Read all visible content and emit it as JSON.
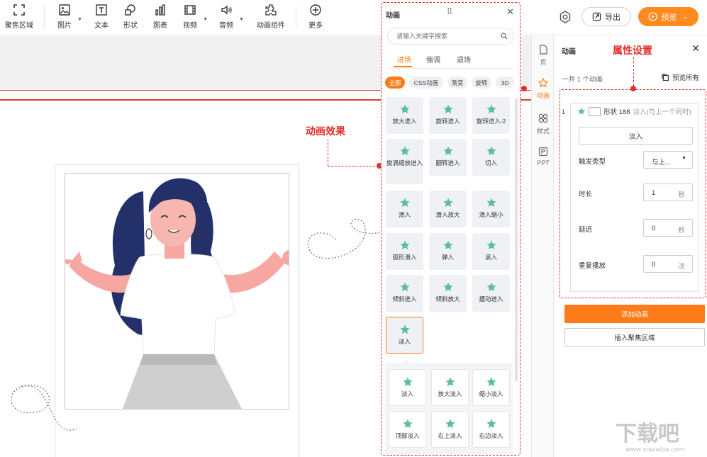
{
  "toolbar": {
    "items": [
      {
        "label": "聚焦区域",
        "icon": "focus-area-icon"
      },
      {
        "label": "图片",
        "icon": "image-icon"
      },
      {
        "label": "文本",
        "icon": "text-icon"
      },
      {
        "label": "形状",
        "icon": "shape-icon"
      },
      {
        "label": "图表",
        "icon": "chart-icon"
      },
      {
        "label": "视频",
        "icon": "video-icon"
      },
      {
        "label": "音频",
        "icon": "audio-icon"
      },
      {
        "label": "动画组件",
        "icon": "animation-component-icon"
      },
      {
        "label": "更多",
        "icon": "more-icon"
      }
    ],
    "export_label": "导出",
    "preview_label": "预览"
  },
  "annotations": {
    "effects": "动画效果",
    "properties": "属性设置"
  },
  "anim_panel": {
    "title": "动画",
    "search_placeholder": "请输入关键字搜索",
    "tabs": [
      "进场",
      "强调",
      "退场"
    ],
    "chips": [
      "全部",
      "CSS动画",
      "渐变",
      "旋转",
      "3D"
    ],
    "effects": [
      "放大进入",
      "旋转进入",
      "旋转进入-2",
      "旋涡缩放进入",
      "翻转进入",
      "切入",
      "滑入",
      "滑入放大",
      "滑入缩小",
      "弧形滑入",
      "弹入",
      "滚入",
      "倾斜进入",
      "倾斜放大",
      "摆动进入",
      "淡入"
    ],
    "sub_effects": [
      "淡入",
      "放大淡入",
      "缩小淡入",
      "顶部淡入",
      "右上淡入",
      "右边淡入"
    ]
  },
  "side_tabs": [
    "页",
    "动画",
    "样式",
    "PPT"
  ],
  "properties": {
    "title": "动画",
    "count_text": "一共 1 个动画",
    "preview_all": "预览所有",
    "item_index": "1",
    "item_name": "形状 188",
    "item_desc": "淡入(与上一个同时)",
    "effect_button": "淡入",
    "trigger_label": "触发类型",
    "trigger_value": "与上...",
    "duration_label": "时长",
    "duration_value": "1",
    "duration_unit": "秒",
    "delay_label": "延迟",
    "delay_value": "0",
    "delay_unit": "秒",
    "repeat_label": "重复播放",
    "repeat_value": "0",
    "repeat_unit": "次",
    "add_button": "添加动画",
    "insert_button": "插入聚焦区域"
  },
  "watermark": {
    "text": "下载吧",
    "url": "www.xiazaiba.com"
  },
  "colors": {
    "accent": "#ff7a18",
    "annotation": "#e4312b",
    "star": "#5cbf9a"
  }
}
